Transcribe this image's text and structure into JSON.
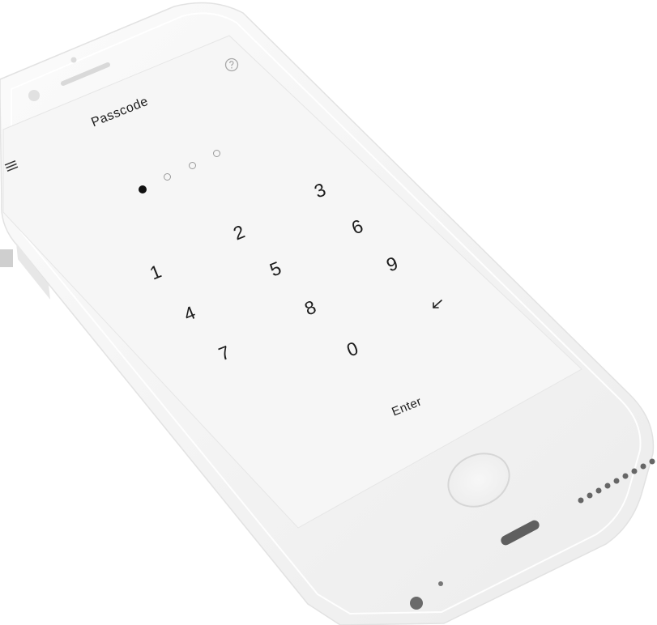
{
  "screen": {
    "title": "Passcode",
    "enter_label": "Enter",
    "icons": {
      "menu": "menu-icon",
      "help": "help-icon",
      "backspace": "backspace-icon"
    }
  },
  "passcode": {
    "length": 4,
    "filled": 1,
    "colors": {
      "filled": "#111111",
      "empty_stroke": "#9a9a9a"
    }
  },
  "keypad": {
    "keys": [
      "1",
      "2",
      "3",
      "4",
      "5",
      "6",
      "7",
      "8",
      "9",
      "0"
    ]
  },
  "theme": {
    "screen_bg": "#f6f6f6",
    "body_bg": "#f1f1f1",
    "text": "#1c1c1c"
  }
}
